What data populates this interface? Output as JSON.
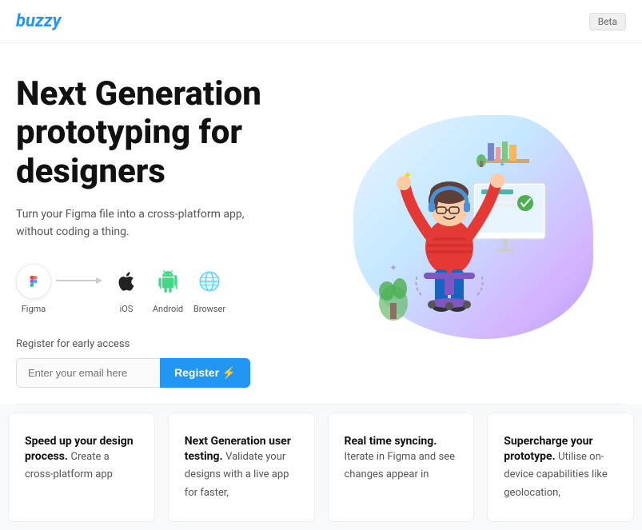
{
  "header": {
    "logo": "buzzy",
    "beta_label": "Beta"
  },
  "hero": {
    "title": "Next Generation prototyping for designers",
    "subtitle": "Turn your Figma file into a cross-platform app, without coding a thing.",
    "platforms": [
      {
        "name": "Figma",
        "id": "figma"
      },
      {
        "name": "iOS",
        "id": "ios"
      },
      {
        "name": "Android",
        "id": "android"
      },
      {
        "name": "Browser",
        "id": "browser"
      }
    ],
    "register_label": "Register for early access",
    "email_placeholder": "Enter your email here",
    "register_btn": "Register ⚡"
  },
  "cards": [
    {
      "title": "Speed up your design process.",
      "text": "Create a cross-platform app"
    },
    {
      "title": "Next Generation user testing.",
      "text": "Validate your designs with a live app for faster,"
    },
    {
      "title": "Real time syncing.",
      "text": "Iterate in Figma and see changes appear in"
    },
    {
      "title": "Supercharge your prototype.",
      "text": "Utilise on-device capabilities like geolocation,"
    }
  ]
}
